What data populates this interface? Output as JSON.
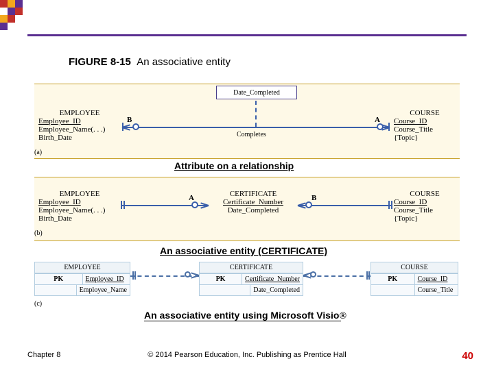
{
  "figure": {
    "label": "FIGURE 8-15",
    "title": "An associative entity"
  },
  "captions": {
    "a": "Attribute on a relationship",
    "b": "An associative entity (CERTIFICATE)",
    "c": "An associative entity using Microsoft Visio"
  },
  "diagram_a": {
    "tag": "(a)",
    "employee": {
      "name": "EMPLOYEE",
      "pk": "Employee_ID",
      "a2": "Employee_Name(. . .)",
      "a3": "Birth_Date"
    },
    "course": {
      "name": "COURSE",
      "pk": "Course_ID",
      "a2": "Course_Title",
      "a3": "{Topic}"
    },
    "rel": "Completes",
    "attr": "Date_Completed",
    "endA": "A",
    "endB": "B"
  },
  "diagram_b": {
    "tag": "(b)",
    "employee": {
      "name": "EMPLOYEE",
      "pk": "Employee_ID",
      "a2": "Employee_Name(. . .)",
      "a3": "Birth_Date"
    },
    "certificate": {
      "name": "CERTIFICATE",
      "pk": "Certificate_Number",
      "a2": "Date_Completed"
    },
    "course": {
      "name": "COURSE",
      "pk": "Course_ID",
      "a2": "Course_Title",
      "a3": "{Topic}"
    },
    "endA": "A",
    "endB": "B"
  },
  "diagram_c": {
    "tag": "(c)",
    "pk_label": "PK",
    "employee": {
      "name": "EMPLOYEE",
      "pk": "Employee_ID",
      "a2": "Employee_Name"
    },
    "certificate": {
      "name": "CERTIFICATE",
      "pk": "Certificate_Number",
      "a2": "Date_Completed"
    },
    "course": {
      "name": "COURSE",
      "pk": "Course_ID",
      "a2": "Course_Title"
    }
  },
  "footer": {
    "chapter": "Chapter 8",
    "copy": "© 2014 Pearson Education, Inc. Publishing as Prentice Hall",
    "page": "40"
  },
  "reg": "®"
}
